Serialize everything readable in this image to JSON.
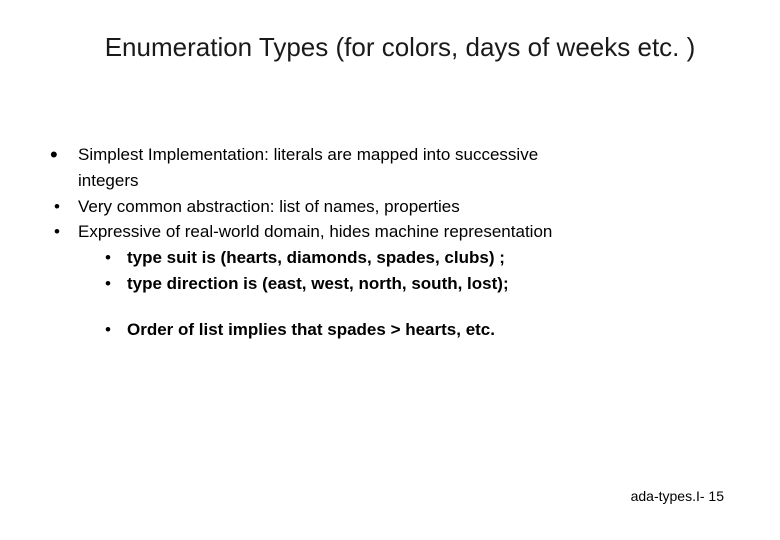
{
  "title": "Enumeration Types (for colors, days of weeks etc. )",
  "bullets": {
    "b1_line1": " Simplest Implementation: literals are mapped into successive",
    "b1_line2": "integers",
    "b2": " Very common abstraction: list of names, properties",
    "b3": " Expressive of real-world domain, hides machine representation",
    "sub1_pre": "type suit is ",
    "sub1_post": "(hearts, diamonds, spades, clubs) ;",
    "sub2_pre": "type direction is ",
    "sub2_post": "(east, west, north, south, lost);",
    "sub3": "Order of list implies that spades > hearts, etc."
  },
  "footer": "ada-types.I- 15"
}
